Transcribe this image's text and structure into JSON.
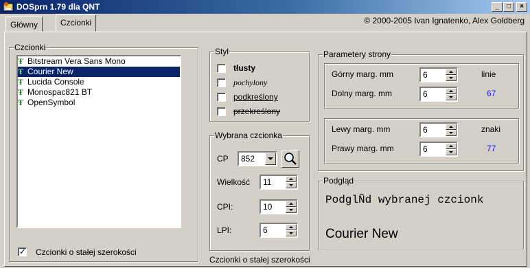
{
  "window": {
    "title": "DOSprn 1.79 dla QNT",
    "controls": {
      "minimize": "_",
      "maximize": "□",
      "close": "×"
    }
  },
  "tabs": [
    {
      "label": "Główny",
      "active": false
    },
    {
      "label": "Czcionki",
      "active": true
    }
  ],
  "copyright": "© 2000-2005 Ivan Ignatenko, Alex Goldberg",
  "fonts_group": {
    "title": "Czcionki",
    "items": [
      {
        "label": "Bitstream Vera Sans Mono",
        "icon": "truetype-icon",
        "selected": false
      },
      {
        "label": "Courier New",
        "icon": "truetype-icon",
        "selected": true
      },
      {
        "label": "Lucida Console",
        "icon": "truetype-icon",
        "selected": false
      },
      {
        "label": "Monospac821 BT",
        "icon": "truetype-icon",
        "selected": false
      },
      {
        "label": "OpenSymbol",
        "icon": "truetype-icon",
        "selected": false
      }
    ],
    "fixed_width_checkbox": {
      "label": "Czcionki o stałej szerokości",
      "checked": true
    }
  },
  "style_group": {
    "title": "Styl",
    "bold": "tłusty",
    "italic": "pochylony",
    "underline": "podkreślony",
    "strikeout": "przekreślony"
  },
  "selected_font_group": {
    "title": "Wybrana czcionka",
    "cp_label": "CP",
    "cp_value": "852",
    "size_label": "Wielkość",
    "size_value": "11",
    "cpi_label": "CPI:",
    "cpi_value": "10",
    "lpi_label": "LPI:",
    "lpi_value": "6"
  },
  "status_text": "Czcionki o stałej szerokości",
  "page_params": {
    "title": "Parametery strony",
    "top_margin_label": "Górny marg. mm",
    "top_margin_value": "6",
    "bottom_margin_label": "Dolny marg. mm",
    "bottom_margin_value": "6",
    "lines_label": "linie",
    "lines_value": "67",
    "left_margin_label": "Lewy marg. mm",
    "left_margin_value": "6",
    "right_margin_label": "Prawy marg. mm",
    "right_margin_value": "6",
    "chars_label": "znaki",
    "chars_value": "77"
  },
  "preview": {
    "title": "Podgląd",
    "sample_text": "PodglÑd wybranej czcionk",
    "font_name": "Courier New"
  },
  "colors": {
    "accent_blue": "#1a1aff",
    "title_bar": "#0a246a",
    "selection": "#0a246a"
  }
}
